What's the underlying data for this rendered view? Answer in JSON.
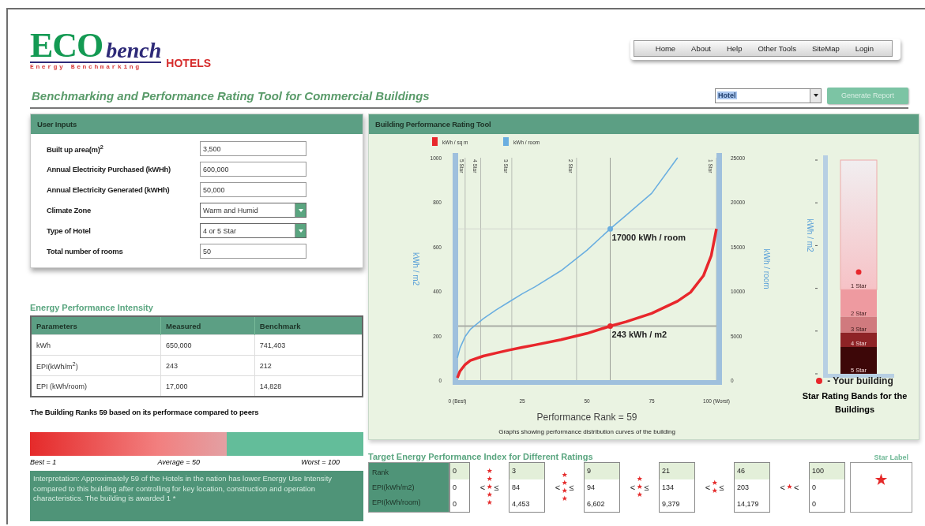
{
  "logo": {
    "mark": "ECO",
    "word": "bench",
    "tagline": "Energy Benchmarking",
    "product": "HOTELS"
  },
  "nav": [
    "Home",
    "About",
    "Help",
    "Other Tools",
    "SiteMap",
    "Login"
  ],
  "title": "Benchmarking and Performance Rating Tool for Commercial Buildings",
  "building_type": {
    "value": "Hotel"
  },
  "generate_button": {
    "label": "Generate Report",
    "disabled": true
  },
  "user_inputs": {
    "title": "User Inputs",
    "fields": [
      {
        "kind": "text",
        "label": "Built up area(m)$^{2}$",
        "value": "3,500"
      },
      {
        "kind": "text",
        "label": "Annual Electricity Purchased (kWHh)",
        "value": "600,000"
      },
      {
        "kind": "text",
        "label": "Annual Electricity Generated (kWHh)",
        "value": "50,000"
      },
      {
        "kind": "select",
        "label": "Climate Zone",
        "value": "Warm and Humid"
      },
      {
        "kind": "select",
        "label": "Type of Hotel",
        "value": "4 or 5 Star"
      },
      {
        "kind": "text",
        "label": "Total number of rooms",
        "value": "50"
      }
    ]
  },
  "epi": {
    "title": "Energy Performance Intensity",
    "columns": [
      "Parameters",
      "Measured",
      "Benchmark"
    ],
    "rows": [
      [
        "kWh",
        "650,000",
        "741,403"
      ],
      [
        "EPI(kWh/m$^{2}$)",
        "243",
        "212"
      ],
      [
        "EPI (kWh/room)",
        "17,000",
        "14,828"
      ]
    ]
  },
  "rank": {
    "text": "The Building Ranks 59 based on its performace compared to peers",
    "level": 0.59,
    "labels": [
      "Best = 1",
      "Average = 50",
      "Worst = 100"
    ]
  },
  "interpretation": "Interpretation: Approximately 59 of the Hotels in the nation has lower Energy Use Intensity compared to this building after controlling for key location, construction and operation characteristics. The building is awarded 1 *",
  "rating_tool": {
    "title": "Building Performance Rating Tool",
    "caption": "Graphs showing performance distribution curves of the building",
    "chart_data": {
      "type": "line",
      "xlabel": "Performance Rank = 59",
      "ylabel": "kWh / m2",
      "y2label": "kWh / room",
      "x": [
        0,
        1,
        3,
        5,
        10,
        15,
        20,
        25,
        30,
        40,
        50,
        59,
        65,
        75,
        85,
        90,
        95,
        98,
        100
      ],
      "series": [
        {
          "name": "kWh / sq m",
          "color": "#e8272c",
          "values": [
            10,
            40,
            70,
            88,
            108,
            122,
            135,
            147,
            158,
            182,
            210,
            243,
            262,
            300,
            355,
            395,
            470,
            560,
            680
          ]
        },
        {
          "name": "kWh / room",
          "color": "#6aaee0",
          "axis": "y2",
          "values": [
            2500,
            3600,
            4900,
            5700,
            6900,
            7900,
            8800,
            9700,
            10500,
            12300,
            14600,
            17000,
            18500,
            21000,
            25000,
            null,
            null,
            null,
            null
          ]
        }
      ],
      "xlim": [
        0,
        100
      ],
      "ylim": [
        0,
        1000
      ],
      "y2lim": [
        0,
        25000
      ],
      "xticks": [
        {
          "value": 0,
          "label": "0 (Best)"
        },
        25,
        50,
        75,
        {
          "value": 100,
          "label": "100 (Worst)"
        }
      ],
      "yticks": [
        0,
        200,
        400,
        600,
        800,
        1000
      ],
      "y2ticks": [
        0,
        5000,
        10000,
        15000,
        20000,
        25000
      ],
      "legend": "top",
      "ref_lines": [
        {
          "axis": "x",
          "value": 3,
          "label": "5 Star"
        },
        {
          "axis": "x",
          "value": 9,
          "label": "4 Star"
        },
        {
          "axis": "x",
          "value": 21,
          "label": "3 Star"
        },
        {
          "axis": "x",
          "value": 46,
          "label": "2 Star"
        },
        {
          "axis": "x",
          "value": 100,
          "label": "1 Star"
        },
        {
          "axis": "x",
          "value": 59
        },
        {
          "axis": "y",
          "value": 243
        },
        {
          "axis": "y",
          "value": 680
        }
      ],
      "annotations": [
        {
          "x": 59,
          "y": 680,
          "text": "17000 kWh / room"
        },
        {
          "x": 59,
          "y": 243,
          "text": "243 kWh / m2"
        }
      ]
    },
    "star_bands": {
      "ylabel": "kWh / m2",
      "bands": [
        {
          "label": "1 Star",
          "color": "#f6c2c6"
        },
        {
          "label": "2 Star",
          "color": "#ee9aa0"
        },
        {
          "label": "3 Star",
          "color": "#d07a7e"
        },
        {
          "label": "4 Star",
          "color": "#8e2326"
        },
        {
          "label": "5 Star",
          "color": "#3d0708"
        }
      ],
      "legend": "- Your building",
      "caption": "Star Rating Bands for the Buildings"
    }
  },
  "target": {
    "title": "Target Energy Performance Index for Different Ratings",
    "row_labels": [
      "Rank",
      "EPI(kWh/m2)",
      "EPI(kWh/room)"
    ],
    "columns": [
      [
        "0",
        "0",
        "0"
      ],
      [
        "3",
        "84",
        "4,453"
      ],
      [
        "9",
        "94",
        "6,602"
      ],
      [
        "21",
        "134",
        "9,379"
      ],
      [
        "46",
        "203",
        "14,179"
      ],
      [
        "100",
        "0",
        "0"
      ]
    ],
    "separators": [
      {
        "left": "<",
        "symbol": "★★★★★",
        "right": "≤"
      },
      {
        "left": "<",
        "symbol": "★★★★",
        "right": "≤"
      },
      {
        "left": "<",
        "symbol": "★★★",
        "right": "≤"
      },
      {
        "left": "<",
        "symbol": "★★",
        "right": "≤"
      },
      {
        "left": "<",
        "symbol": "★",
        "right": "<"
      }
    ],
    "star_label": {
      "heading": "Star Label",
      "symbol": "★"
    }
  }
}
